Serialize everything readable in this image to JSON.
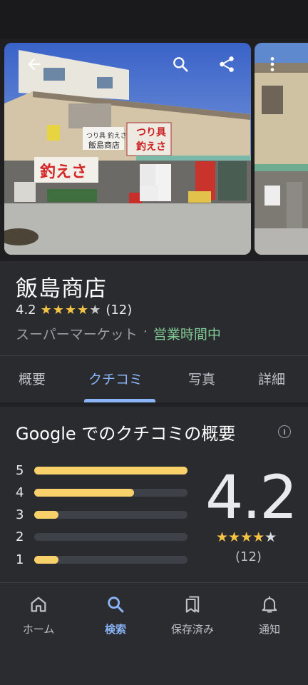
{
  "place": {
    "name": "飯島商店",
    "rating": "4.2",
    "review_count": "(12)",
    "category": "スーパーマーケット",
    "separator": "·",
    "status": "営業時間中"
  },
  "photo": {
    "signs": {
      "main_sign": "つり具 釣えさ",
      "store_sign": "飯島商店",
      "banner": "釣えさ"
    }
  },
  "tabs": [
    {
      "label": "概要"
    },
    {
      "label": "クチコミ"
    },
    {
      "label": "写真"
    },
    {
      "label": "詳細"
    }
  ],
  "reviews": {
    "title": "Google でのクチコミの概要",
    "score": "4.2",
    "count": "(12)",
    "distribution": [
      {
        "star": "5",
        "fraction": 1.0
      },
      {
        "star": "4",
        "fraction": 0.65
      },
      {
        "star": "3",
        "fraction": 0.16
      },
      {
        "star": "2",
        "fraction": 0.0
      },
      {
        "star": "1",
        "fraction": 0.16
      }
    ]
  },
  "bottom_nav": [
    {
      "label": "ホーム",
      "icon": "home-icon"
    },
    {
      "label": "検索",
      "icon": "search-icon"
    },
    {
      "label": "保存済み",
      "icon": "bookmark-icon"
    },
    {
      "label": "通知",
      "icon": "bell-icon"
    }
  ],
  "colors": {
    "accent": "#8ab4f8",
    "star": "#f6c445",
    "open": "#81c995",
    "bar": "#f9d16a"
  }
}
